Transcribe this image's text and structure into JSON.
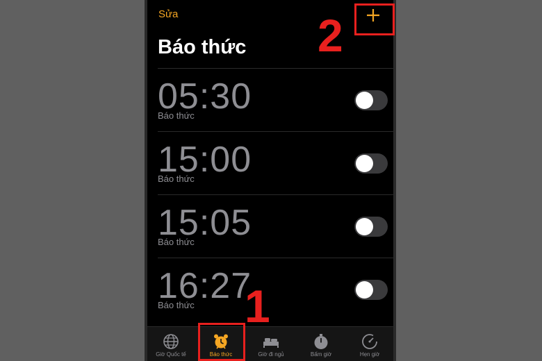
{
  "header": {
    "edit_label": "Sửa",
    "add_icon": "plus-icon",
    "title": "Báo thức"
  },
  "alarms": [
    {
      "time": "05:30",
      "label": "Báo thức",
      "enabled": false
    },
    {
      "time": "15:00",
      "label": "Báo thức",
      "enabled": false
    },
    {
      "time": "15:05",
      "label": "Báo thức",
      "enabled": false
    },
    {
      "time": "16:27",
      "label": "Báo thức",
      "enabled": false
    }
  ],
  "tabbar": {
    "tabs": [
      {
        "label": "Giờ Quốc tế",
        "icon": "globe-icon",
        "active": false
      },
      {
        "label": "Báo thức",
        "icon": "alarm-clock-icon",
        "active": true
      },
      {
        "label": "Giờ đi ngủ",
        "icon": "bed-icon",
        "active": false
      },
      {
        "label": "Bấm giờ",
        "icon": "stopwatch-icon",
        "active": false
      },
      {
        "label": "Hẹn giờ",
        "icon": "timer-icon",
        "active": false
      }
    ]
  },
  "annotations": {
    "step1": "1",
    "step2": "2"
  },
  "colors": {
    "accent": "#f5a623",
    "highlight": "#e8201e",
    "background": "#000000",
    "secondary_text": "#8e8e93"
  }
}
